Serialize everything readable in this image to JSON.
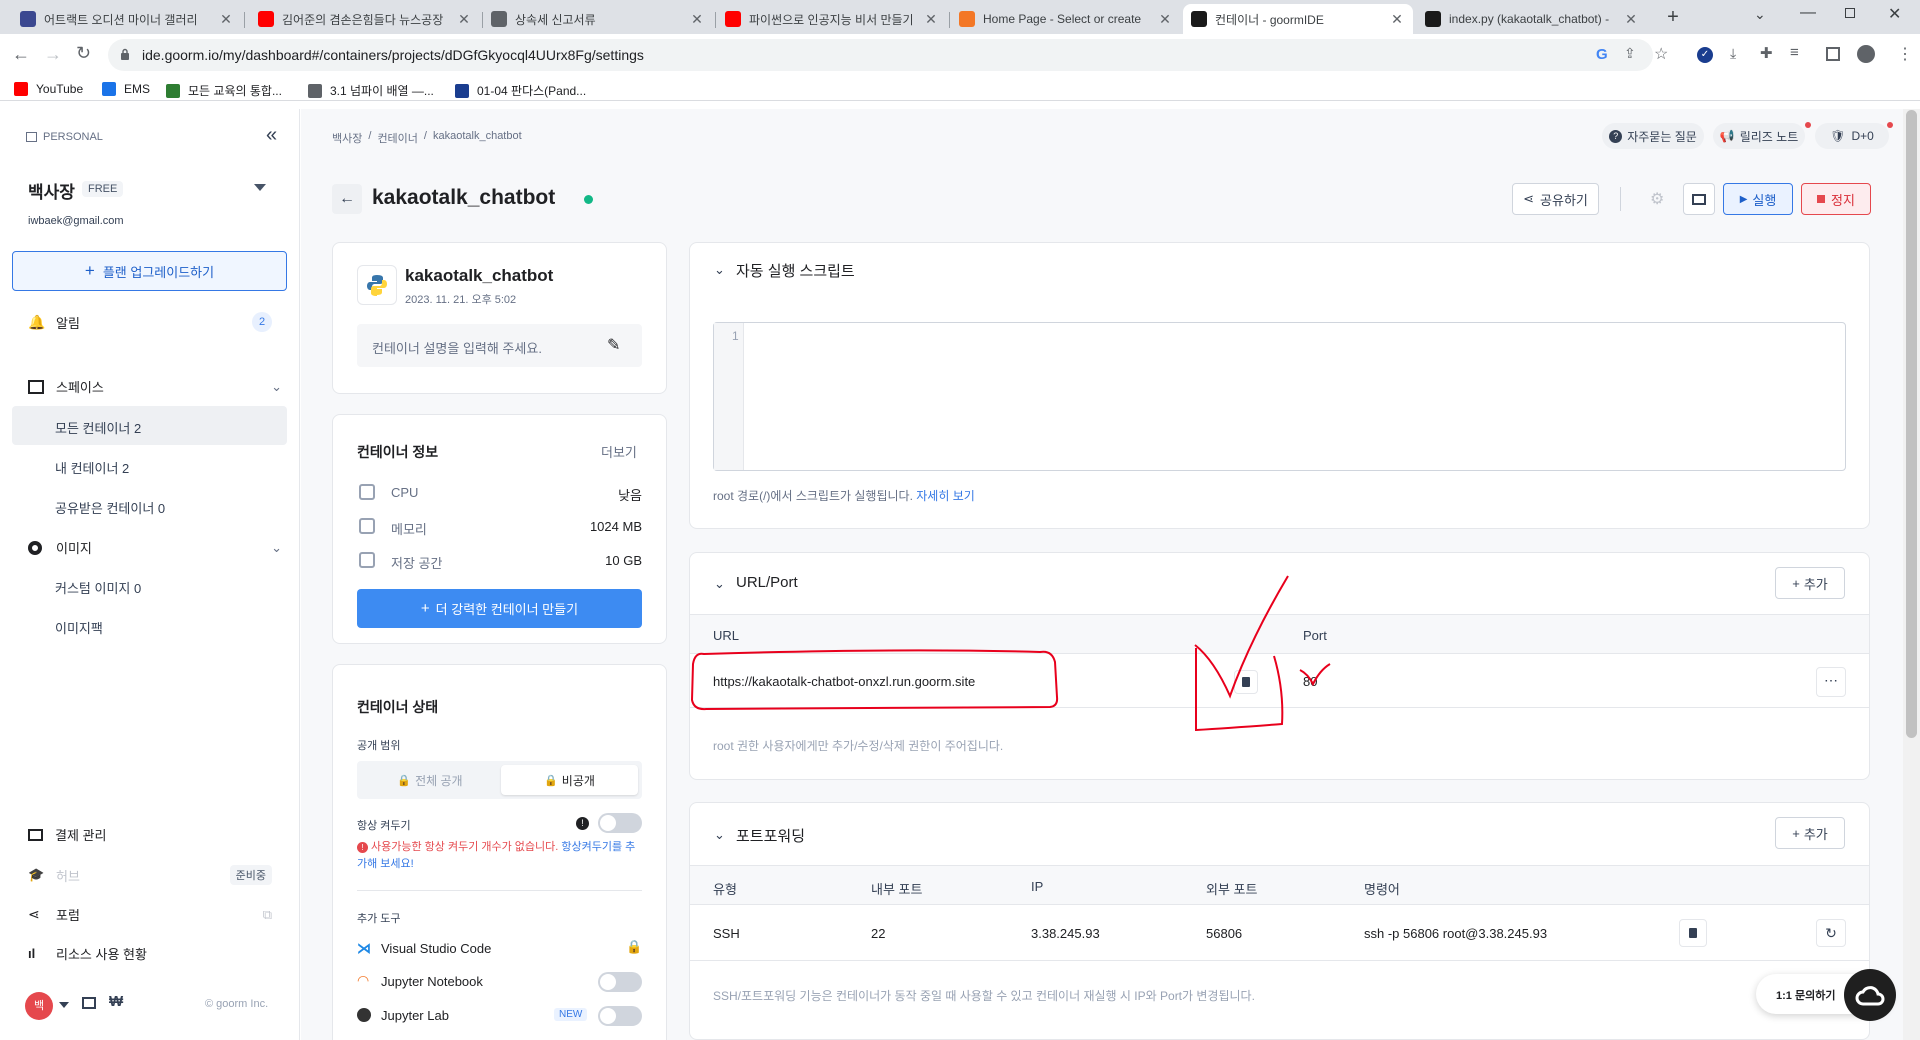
{
  "browser": {
    "tabs": [
      {
        "title": "어트랙트 오디션 마이너 갤러리",
        "icon_color": "#3b4890",
        "active": false
      },
      {
        "title": "김어준의 겸손은힘들다 뉴스공장",
        "icon_color": "#ff0000",
        "active": false
      },
      {
        "title": "상속세 신고서류",
        "icon_color": "#5f6368",
        "active": false
      },
      {
        "title": "파이썬으로 인공지능 비서 만들기",
        "icon_color": "#ff0000",
        "active": false
      },
      {
        "title": "Home Page - Select or create",
        "icon_color": "#f37726",
        "active": false
      },
      {
        "title": "컨테이너 - goormIDE",
        "icon_color": "#1a1a1a",
        "active": true
      },
      {
        "title": "index.py (kakaotalk_chatbot) -",
        "icon_color": "#1a1a1a",
        "active": false
      }
    ],
    "url": "ide.goorm.io/my/dashboard#/containers/projects/dDGfGkyocql4UUrx8Fg/settings",
    "bookmarks": [
      {
        "label": "YouTube",
        "color": "#ff0000"
      },
      {
        "label": "EMS",
        "color": "#1a73e8"
      },
      {
        "label": "모든 교육의 통합...",
        "color": "#2e7d32"
      },
      {
        "label": "3.1 넘파이 배열 —...",
        "color": "#5f6368"
      },
      {
        "label": "01-04 판다스(Pand...",
        "color": "#1a3d8f"
      }
    ]
  },
  "sidebar": {
    "workspace_label": "PERSONAL",
    "user_name": "백사장",
    "plan_badge": "FREE",
    "email": "iwbaek@gmail.com",
    "upgrade_label": "플랜 업그레이드하기",
    "notifications_label": "알림",
    "notifications_count": "2",
    "spaces_label": "스페이스",
    "all_containers": "모든 컨테이너 2",
    "my_containers": "내 컨테이너 2",
    "shared_containers": "공유받은 컨테이너 0",
    "images_label": "이미지",
    "custom_images": "커스텀 이미지 0",
    "image_market": "이미지팩",
    "billing": "결제 관리",
    "hub": "허브",
    "hub_badge": "준비중",
    "forum": "포럼",
    "resource_usage": "리소스 사용 현황",
    "avatar_letter": "백",
    "copyright": "© goorm Inc."
  },
  "header": {
    "breadcrumb": [
      "백사장",
      "컨테이너",
      "kakaotalk_chatbot"
    ],
    "faq": "자주묻는 질문",
    "release_notes": "릴리즈 노트",
    "dday": "D+0",
    "title": "kakaotalk_chatbot",
    "share": "공유하기",
    "run": "실행",
    "stop": "정지"
  },
  "container_card": {
    "name": "kakaotalk_chatbot",
    "created": "2023. 11. 21. 오후 5:02",
    "description_placeholder": "컨테이너 설명을 입력해 주세요."
  },
  "info_card": {
    "title": "컨테이너 정보",
    "more": "더보기",
    "rows": [
      {
        "label": "CPU",
        "value": "낮음"
      },
      {
        "label": "메모리",
        "value": "1024 MB"
      },
      {
        "label": "저장 공간",
        "value": "10 GB"
      }
    ],
    "upgrade_button": "더 강력한 컨테이너 만들기"
  },
  "status_card": {
    "title": "컨테이너 상태",
    "visibility_label": "공개 범위",
    "public": "전체 공개",
    "private": "비공개",
    "always_on_label": "항상 켜두기",
    "warning_text": "사용가능한 항상 켜두기 개수가 없습니다.",
    "warning_link": "항상켜두기를 추가해 보세요!",
    "tools_label": "추가 도구",
    "tools": [
      {
        "name": "Visual Studio Code",
        "locked": true
      },
      {
        "name": "Jupyter Notebook",
        "locked": false
      },
      {
        "name": "Jupyter Lab",
        "locked": false,
        "badge": "NEW"
      }
    ]
  },
  "script_section": {
    "title": "자동 실행 스크립트",
    "line_number": "1",
    "hint": "root 경로(/)에서 스크립트가 실행됩니다.",
    "hint_link": "자세히 보기"
  },
  "url_section": {
    "title": "URL/Port",
    "add": "추가",
    "col_url": "URL",
    "col_port": "Port",
    "url": "https://kakaotalk-chatbot-onxzl.run.goorm.site",
    "port": "80",
    "note": "root 권한 사용자에게만 추가/수정/삭제 권한이 주어집니다."
  },
  "port_section": {
    "title": "포트포워딩",
    "add": "추가",
    "columns": [
      "유형",
      "내부 포트",
      "IP",
      "외부 포트",
      "명령어"
    ],
    "row": {
      "type": "SSH",
      "internal": "22",
      "ip": "3.38.245.93",
      "external": "56806",
      "command": "ssh -p 56806 root@3.38.245.93"
    },
    "note": "SSH/포트포워딩 기능은 컨테이너가 동작 중일 때 사용할 수 있고 컨테이너 재실행 시 IP와 Port가 변경됩니다."
  },
  "chat_widget": {
    "label": "1:1 문의하기"
  },
  "colors": {
    "primary": "#3578e5",
    "danger": "#e5484d",
    "online": "#12b886",
    "annotation_red": "#e8001c"
  }
}
